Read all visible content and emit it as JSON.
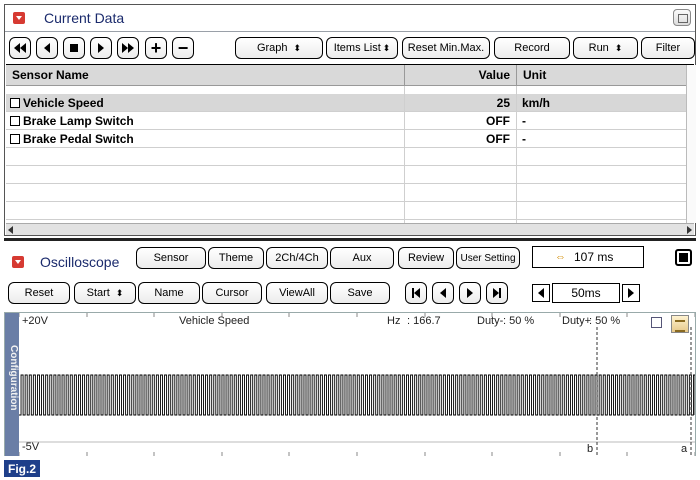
{
  "current_data": {
    "title": "Current Data",
    "toolbar": {
      "graph": "Graph",
      "items_list": "Items List",
      "reset_min_max": "Reset Min.Max.",
      "record": "Record",
      "run": "Run",
      "filter": "Filter"
    },
    "columns": {
      "name": "Sensor Name",
      "value": "Value",
      "unit": "Unit"
    },
    "rows": [
      {
        "name": "Vehicle Speed",
        "value": "25",
        "unit": "km/h",
        "selected": true
      },
      {
        "name": "Brake Lamp Switch",
        "value": "OFF",
        "unit": "-"
      },
      {
        "name": "Brake Pedal Switch",
        "value": "OFF",
        "unit": "-"
      }
    ]
  },
  "oscilloscope": {
    "title": "Oscilloscope",
    "top_buttons": {
      "sensor": "Sensor",
      "theme": "Theme",
      "channels": "2Ch/4Ch",
      "aux": "Aux",
      "review": "Review",
      "user_setting": "User Setting"
    },
    "time_value": "107 ms",
    "bottom_buttons": {
      "reset": "Reset",
      "start": "Start",
      "name": "Name",
      "cursor": "Cursor",
      "view_all": "ViewAll",
      "save": "Save"
    },
    "time_div": "50ms",
    "config_tab": "Configuration",
    "readout": {
      "y_max": "+20V",
      "y_min": "-5V",
      "channel": "Vehicle Speed",
      "hz_label": "Hz",
      "hz_value": ": 166.7",
      "duty_minus_label": "Duty-",
      "duty_minus_value": ": 50 %",
      "duty_plus_label": "Duty+",
      "duty_plus_value": ": 50 %"
    },
    "cursor_b": "b",
    "cursor_a": "a",
    "signal_colors": {
      "trace": "#000000",
      "config_tab": "#6a7ea6",
      "accent": "#d63a32"
    }
  },
  "figure_label": "Fig.2"
}
